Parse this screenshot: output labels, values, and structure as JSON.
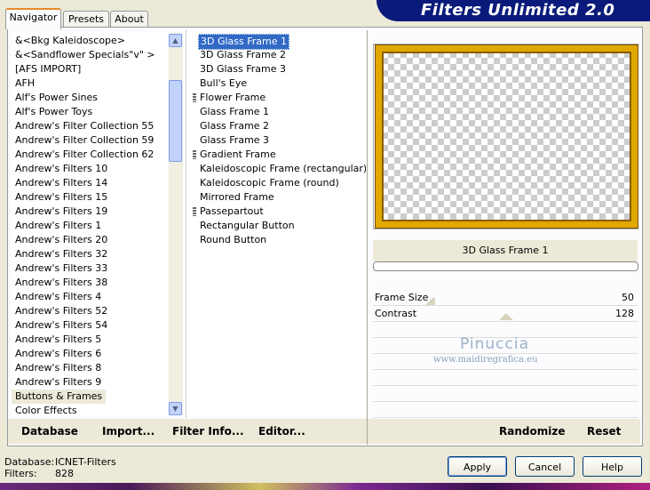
{
  "tabs": [
    {
      "label": "Navigator",
      "active": true
    },
    {
      "label": "Presets",
      "active": false
    },
    {
      "label": "About",
      "active": false
    }
  ],
  "banner": {
    "title": "Filters Unlimited 2.0"
  },
  "categories": [
    "&<Bkg Kaleidoscope>",
    "&<Sandflower Specials\"v\" >",
    "[AFS IMPORT]",
    "AFH",
    "Alf's Power Sines",
    "Alf's Power Toys",
    "Andrew's Filter Collection 55",
    "Andrew's Filter Collection 59",
    "Andrew's Filter Collection 62",
    "Andrew's Filters 10",
    "Andrew's Filters 14",
    "Andrew's Filters 15",
    "Andrew's Filters 19",
    "Andrew's Filters 1",
    "Andrew's Filters 20",
    "Andrew's Filters 32",
    "Andrew's Filters 33",
    "Andrew's Filters 38",
    "Andrew's Filters 4",
    "Andrew's Filters 52",
    "Andrew's Filters 54",
    "Andrew's Filters 5",
    "Andrew's Filters 6",
    "Andrew's Filters 8",
    "Andrew's Filters 9",
    "Buttons & Frames",
    "Color Effects"
  ],
  "selected_category": "Buttons & Frames",
  "filters": [
    {
      "label": "3D Glass Frame 1",
      "grouped": false
    },
    {
      "label": "3D Glass Frame 2",
      "grouped": false
    },
    {
      "label": "3D Glass Frame 3",
      "grouped": false
    },
    {
      "label": "Bull's Eye",
      "grouped": false
    },
    {
      "label": "Flower Frame",
      "grouped": true
    },
    {
      "label": "Glass Frame 1",
      "grouped": false
    },
    {
      "label": "Glass Frame 2",
      "grouped": false
    },
    {
      "label": "Glass Frame 3",
      "grouped": false
    },
    {
      "label": "Gradient Frame",
      "grouped": true
    },
    {
      "label": "Kaleidoscopic Frame (rectangular)",
      "grouped": false
    },
    {
      "label": "Kaleidoscopic Frame (round)",
      "grouped": false
    },
    {
      "label": "Mirrored Frame",
      "grouped": false
    },
    {
      "label": "Passepartout",
      "grouped": true
    },
    {
      "label": "Rectangular Button",
      "grouped": false
    },
    {
      "label": "Round Button",
      "grouped": false
    }
  ],
  "selected_filter": "3D Glass Frame 1",
  "preview": {
    "filter_name": "3D Glass Frame 1",
    "frame_color": "#e0a800"
  },
  "params": [
    {
      "label": "Frame Size",
      "value": "50",
      "level": 0.2
    },
    {
      "label": "Contrast",
      "value": "128",
      "level": 0.5
    }
  ],
  "watermark": {
    "title": "Pinuccia",
    "url": "www.maidiregrafica.eu"
  },
  "bottom_links": {
    "database": "Database",
    "import": "Import...",
    "filter_info": "Filter Info...",
    "editor": "Editor...",
    "randomize": "Randomize",
    "reset": "Reset"
  },
  "status": {
    "database_label": "Database:",
    "database_value": "ICNET-Filters",
    "filters_label": "Filters:",
    "filters_value": "828"
  },
  "buttons": {
    "apply": "Apply",
    "cancel": "Cancel",
    "help": "Help"
  },
  "icons": {
    "scroll_up": "chevron-up-icon",
    "scroll_down": "chevron-down-icon",
    "group": "group-marker-icon"
  }
}
